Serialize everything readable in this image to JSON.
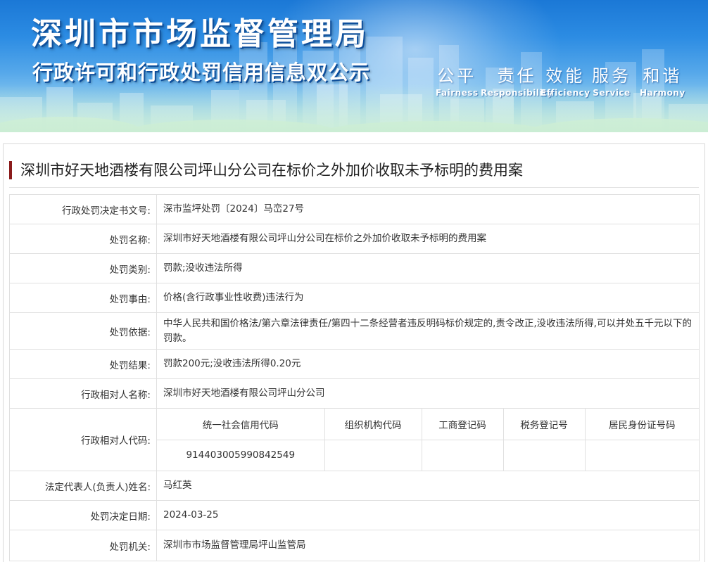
{
  "banner": {
    "title": "深圳市市场监督管理局",
    "subtitle": "行政许可和行政处罚信用信息双公示",
    "motto": [
      {
        "cn": "公平",
        "en": "Fairness"
      },
      {
        "cn": "责任",
        "en": "Responsibility"
      },
      {
        "cn": "效能",
        "en": "Efficiency"
      },
      {
        "cn": "服务",
        "en": "Service"
      },
      {
        "cn": "和谐",
        "en": "Harmony"
      }
    ]
  },
  "case": {
    "title": "深圳市好天地酒楼有限公司坪山分公司在标价之外加价收取未予标明的费用案"
  },
  "fields": {
    "decision_no": {
      "label": "行政处罚决定书文号:",
      "value": "深市监坪处罚〔2024〕马峦27号"
    },
    "penalty_name": {
      "label": "处罚名称:",
      "value": "深圳市好天地酒楼有限公司坪山分公司在标价之外加价收取未予标明的费用案"
    },
    "penalty_type": {
      "label": "处罚类别:",
      "value": "罚款;没收违法所得"
    },
    "penalty_reason": {
      "label": "处罚事由:",
      "value": "价格(含行政事业性收费)违法行为"
    },
    "penalty_basis": {
      "label": "处罚依据:",
      "value": "中华人民共和国价格法/第六章法律责任/第四十二条经营者违反明码标价规定的,责令改正,没收违法所得,可以并处五千元以下的罚款。"
    },
    "penalty_result": {
      "label": "处罚结果:",
      "value": "罚款200元;没收违法所得0.20元"
    },
    "party_name": {
      "label": "行政相对人名称:",
      "value": "深圳市好天地酒楼有限公司坪山分公司"
    },
    "party_code": {
      "label": "行政相对人代码:",
      "headers": [
        "统一社会信用代码",
        "组织机构代码",
        "工商登记码",
        "税务登记号",
        "居民身份证号码"
      ],
      "values": [
        "914403005990842549",
        "",
        "",
        "",
        ""
      ]
    },
    "legal_rep": {
      "label": "法定代表人(负责人)姓名:",
      "value": "马红英"
    },
    "decision_date": {
      "label": "处罚决定日期:",
      "value": "2024-03-25"
    },
    "authority": {
      "label": "处罚机关:",
      "value": "深圳市市场监督管理局坪山监管局"
    }
  },
  "colors": {
    "banner_top": "#1b78d6",
    "banner_bottom": "#c9eaf3",
    "title_mark": "#8a1b1b",
    "border": "#e0e0e0"
  }
}
